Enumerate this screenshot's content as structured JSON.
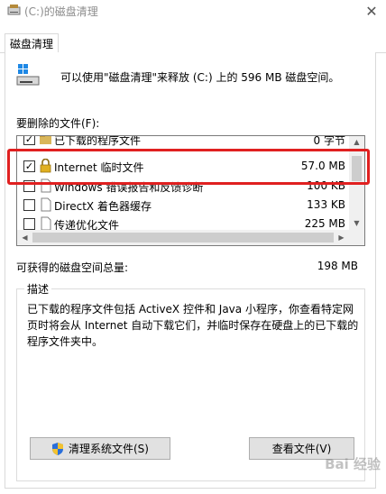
{
  "window": {
    "title": "(C:)的磁盘清理",
    "close_symbol": "✕"
  },
  "tabs": [
    {
      "label": "磁盘清理",
      "active": true
    }
  ],
  "header": {
    "message": "可以使用\"磁盘清理\"来释放 (C:) 上的 596 MB 磁盘空间。"
  },
  "files_section": {
    "label": "要删除的文件(F):",
    "items": [
      {
        "name": "已下载的程序文件",
        "size": "0 字节",
        "checked": true,
        "icon": "folder-icon"
      },
      {
        "name": "Internet 临时文件",
        "size": "57.0 MB",
        "checked": true,
        "icon": "lock-icon"
      },
      {
        "name": "Windows 错误报告和反馈诊断",
        "size": "100 KB",
        "checked": false,
        "icon": "document-icon"
      },
      {
        "name": "DirectX 着色器缓存",
        "size": "133 KB",
        "checked": false,
        "icon": "document-icon"
      },
      {
        "name": "传递优化文件",
        "size": "225 MB",
        "checked": false,
        "icon": "document-icon"
      }
    ]
  },
  "total": {
    "label": "可获得的磁盘空间总量:",
    "value": "198 MB"
  },
  "description": {
    "title": "描述",
    "text": "已下载的程序文件包括 ActiveX 控件和 Java 小程序，你查看特定网页时将会从 Internet 自动下载它们，并临时保存在硬盘上的已下载的程序文件夹中。"
  },
  "buttons": {
    "clean_system": "清理系统文件(S)",
    "view_files": "查看文件(V)"
  },
  "watermark": "Bai 经验",
  "colors": {
    "highlight": "#e02020",
    "title_text": "#8c8c8c",
    "button_bg": "#e1e1e1"
  }
}
